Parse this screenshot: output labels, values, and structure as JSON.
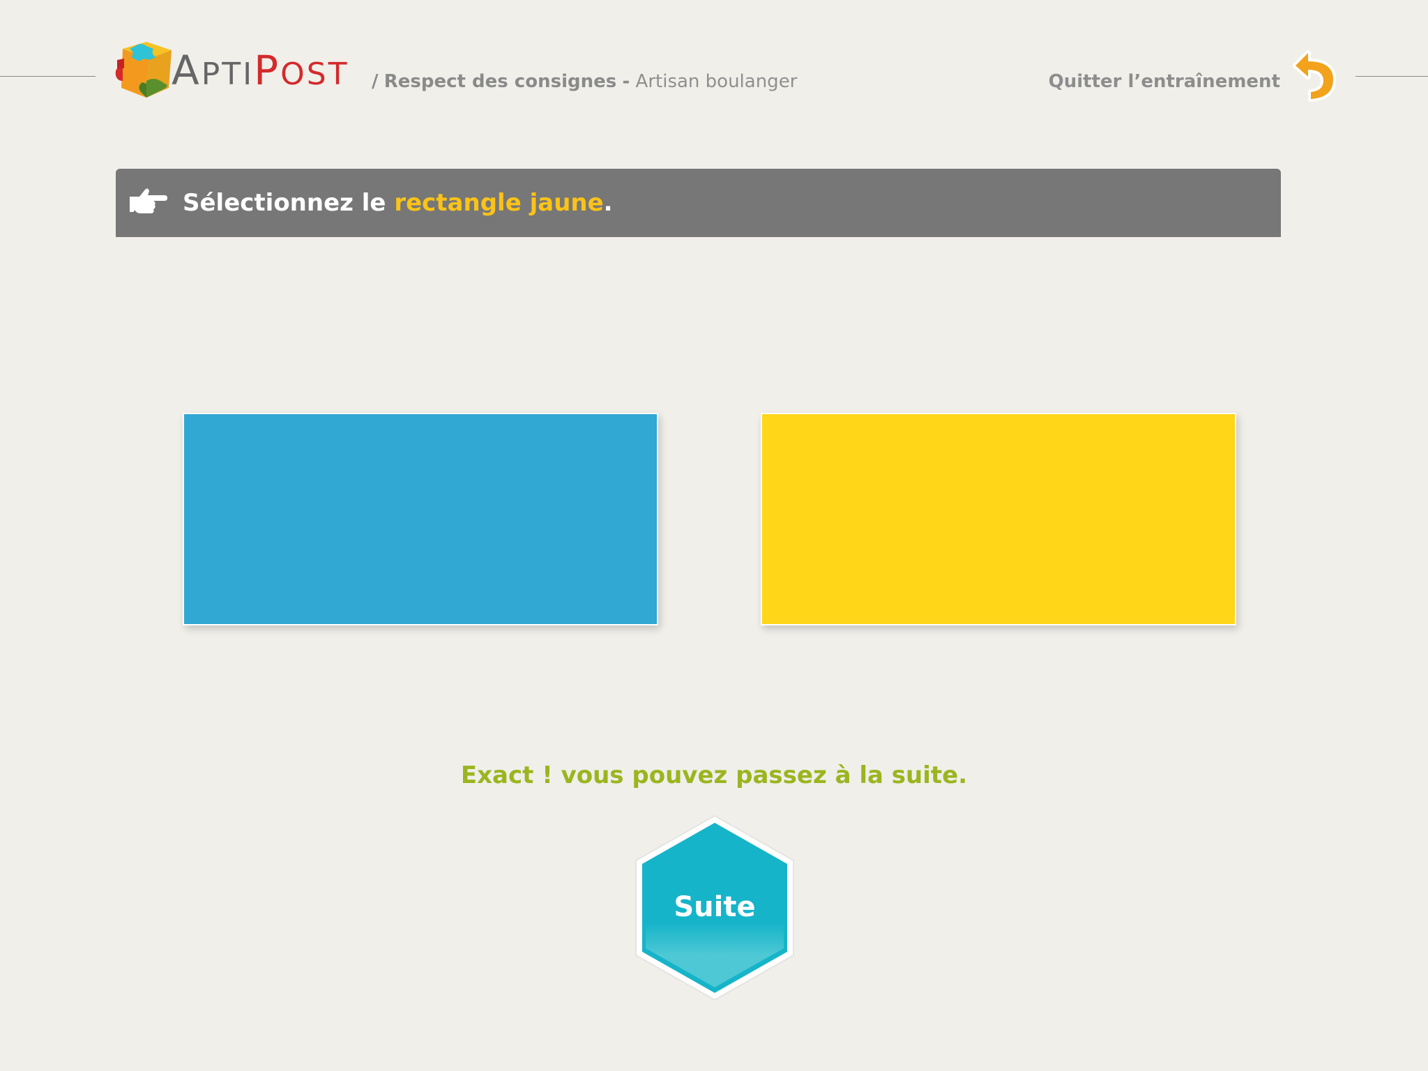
{
  "header": {
    "logo": {
      "brand_part1_initial": "A",
      "brand_part1_rest": "PTI",
      "brand_part2_initial": "P",
      "brand_part2_rest": "OST"
    },
    "breadcrumb": {
      "separator": "/",
      "section": "Respect des consignes",
      "dash": "-",
      "profile": "Artisan boulanger"
    },
    "quit": {
      "label": "Quitter l’entraînement",
      "icon": "return-arrow-icon",
      "icon_color": "#f3a21b"
    }
  },
  "instruction": {
    "icon": "pointing-hand-icon",
    "text_before": "Sélectionnez le ",
    "highlight": "rectangle jaune",
    "text_after": ".",
    "highlight_color": "#fbc318",
    "bar_color": "#777777"
  },
  "choices": [
    {
      "color_name": "blue",
      "color": "#31a7d3"
    },
    {
      "color_name": "yellow",
      "color": "#ffd618"
    }
  ],
  "feedback": {
    "text": "Exact ! vous pouvez passez à la suite.",
    "color": "#9bb51f"
  },
  "next_button": {
    "label": "Suite",
    "color": "#16b4c9"
  }
}
